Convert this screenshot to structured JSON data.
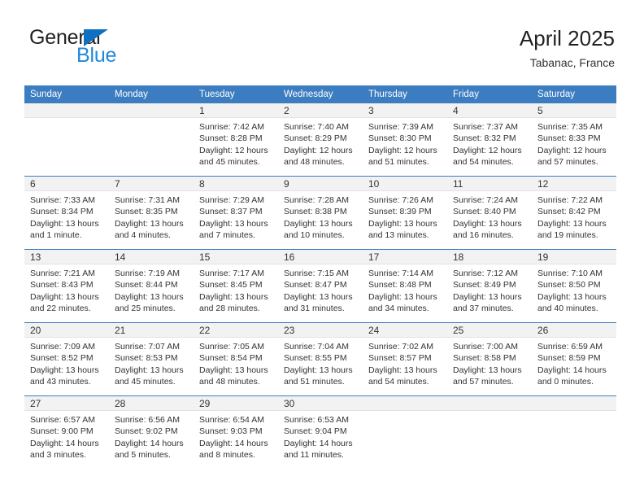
{
  "logo": {
    "word1": "General",
    "word2": "Blue",
    "triangle_color": "#0f6fc0",
    "blue_color": "#2288dd"
  },
  "header": {
    "title": "April 2025",
    "subtitle": "Tabanac, France",
    "accent_color": "#3b7dc0",
    "daynum_band_color": "#f2f2f2"
  },
  "weekdays": [
    "Sunday",
    "Monday",
    "Tuesday",
    "Wednesday",
    "Thursday",
    "Friday",
    "Saturday"
  ],
  "weeks": [
    [
      {
        "day": "",
        "sunrise": "",
        "sunset": "",
        "daylight": "",
        "daylight2": ""
      },
      {
        "day": "",
        "sunrise": "",
        "sunset": "",
        "daylight": "",
        "daylight2": ""
      },
      {
        "day": "1",
        "sunrise": "Sunrise: 7:42 AM",
        "sunset": "Sunset: 8:28 PM",
        "daylight": "Daylight: 12 hours",
        "daylight2": "and 45 minutes."
      },
      {
        "day": "2",
        "sunrise": "Sunrise: 7:40 AM",
        "sunset": "Sunset: 8:29 PM",
        "daylight": "Daylight: 12 hours",
        "daylight2": "and 48 minutes."
      },
      {
        "day": "3",
        "sunrise": "Sunrise: 7:39 AM",
        "sunset": "Sunset: 8:30 PM",
        "daylight": "Daylight: 12 hours",
        "daylight2": "and 51 minutes."
      },
      {
        "day": "4",
        "sunrise": "Sunrise: 7:37 AM",
        "sunset": "Sunset: 8:32 PM",
        "daylight": "Daylight: 12 hours",
        "daylight2": "and 54 minutes."
      },
      {
        "day": "5",
        "sunrise": "Sunrise: 7:35 AM",
        "sunset": "Sunset: 8:33 PM",
        "daylight": "Daylight: 12 hours",
        "daylight2": "and 57 minutes."
      }
    ],
    [
      {
        "day": "6",
        "sunrise": "Sunrise: 7:33 AM",
        "sunset": "Sunset: 8:34 PM",
        "daylight": "Daylight: 13 hours",
        "daylight2": "and 1 minute."
      },
      {
        "day": "7",
        "sunrise": "Sunrise: 7:31 AM",
        "sunset": "Sunset: 8:35 PM",
        "daylight": "Daylight: 13 hours",
        "daylight2": "and 4 minutes."
      },
      {
        "day": "8",
        "sunrise": "Sunrise: 7:29 AM",
        "sunset": "Sunset: 8:37 PM",
        "daylight": "Daylight: 13 hours",
        "daylight2": "and 7 minutes."
      },
      {
        "day": "9",
        "sunrise": "Sunrise: 7:28 AM",
        "sunset": "Sunset: 8:38 PM",
        "daylight": "Daylight: 13 hours",
        "daylight2": "and 10 minutes."
      },
      {
        "day": "10",
        "sunrise": "Sunrise: 7:26 AM",
        "sunset": "Sunset: 8:39 PM",
        "daylight": "Daylight: 13 hours",
        "daylight2": "and 13 minutes."
      },
      {
        "day": "11",
        "sunrise": "Sunrise: 7:24 AM",
        "sunset": "Sunset: 8:40 PM",
        "daylight": "Daylight: 13 hours",
        "daylight2": "and 16 minutes."
      },
      {
        "day": "12",
        "sunrise": "Sunrise: 7:22 AM",
        "sunset": "Sunset: 8:42 PM",
        "daylight": "Daylight: 13 hours",
        "daylight2": "and 19 minutes."
      }
    ],
    [
      {
        "day": "13",
        "sunrise": "Sunrise: 7:21 AM",
        "sunset": "Sunset: 8:43 PM",
        "daylight": "Daylight: 13 hours",
        "daylight2": "and 22 minutes."
      },
      {
        "day": "14",
        "sunrise": "Sunrise: 7:19 AM",
        "sunset": "Sunset: 8:44 PM",
        "daylight": "Daylight: 13 hours",
        "daylight2": "and 25 minutes."
      },
      {
        "day": "15",
        "sunrise": "Sunrise: 7:17 AM",
        "sunset": "Sunset: 8:45 PM",
        "daylight": "Daylight: 13 hours",
        "daylight2": "and 28 minutes."
      },
      {
        "day": "16",
        "sunrise": "Sunrise: 7:15 AM",
        "sunset": "Sunset: 8:47 PM",
        "daylight": "Daylight: 13 hours",
        "daylight2": "and 31 minutes."
      },
      {
        "day": "17",
        "sunrise": "Sunrise: 7:14 AM",
        "sunset": "Sunset: 8:48 PM",
        "daylight": "Daylight: 13 hours",
        "daylight2": "and 34 minutes."
      },
      {
        "day": "18",
        "sunrise": "Sunrise: 7:12 AM",
        "sunset": "Sunset: 8:49 PM",
        "daylight": "Daylight: 13 hours",
        "daylight2": "and 37 minutes."
      },
      {
        "day": "19",
        "sunrise": "Sunrise: 7:10 AM",
        "sunset": "Sunset: 8:50 PM",
        "daylight": "Daylight: 13 hours",
        "daylight2": "and 40 minutes."
      }
    ],
    [
      {
        "day": "20",
        "sunrise": "Sunrise: 7:09 AM",
        "sunset": "Sunset: 8:52 PM",
        "daylight": "Daylight: 13 hours",
        "daylight2": "and 43 minutes."
      },
      {
        "day": "21",
        "sunrise": "Sunrise: 7:07 AM",
        "sunset": "Sunset: 8:53 PM",
        "daylight": "Daylight: 13 hours",
        "daylight2": "and 45 minutes."
      },
      {
        "day": "22",
        "sunrise": "Sunrise: 7:05 AM",
        "sunset": "Sunset: 8:54 PM",
        "daylight": "Daylight: 13 hours",
        "daylight2": "and 48 minutes."
      },
      {
        "day": "23",
        "sunrise": "Sunrise: 7:04 AM",
        "sunset": "Sunset: 8:55 PM",
        "daylight": "Daylight: 13 hours",
        "daylight2": "and 51 minutes."
      },
      {
        "day": "24",
        "sunrise": "Sunrise: 7:02 AM",
        "sunset": "Sunset: 8:57 PM",
        "daylight": "Daylight: 13 hours",
        "daylight2": "and 54 minutes."
      },
      {
        "day": "25",
        "sunrise": "Sunrise: 7:00 AM",
        "sunset": "Sunset: 8:58 PM",
        "daylight": "Daylight: 13 hours",
        "daylight2": "and 57 minutes."
      },
      {
        "day": "26",
        "sunrise": "Sunrise: 6:59 AM",
        "sunset": "Sunset: 8:59 PM",
        "daylight": "Daylight: 14 hours",
        "daylight2": "and 0 minutes."
      }
    ],
    [
      {
        "day": "27",
        "sunrise": "Sunrise: 6:57 AM",
        "sunset": "Sunset: 9:00 PM",
        "daylight": "Daylight: 14 hours",
        "daylight2": "and 3 minutes."
      },
      {
        "day": "28",
        "sunrise": "Sunrise: 6:56 AM",
        "sunset": "Sunset: 9:02 PM",
        "daylight": "Daylight: 14 hours",
        "daylight2": "and 5 minutes."
      },
      {
        "day": "29",
        "sunrise": "Sunrise: 6:54 AM",
        "sunset": "Sunset: 9:03 PM",
        "daylight": "Daylight: 14 hours",
        "daylight2": "and 8 minutes."
      },
      {
        "day": "30",
        "sunrise": "Sunrise: 6:53 AM",
        "sunset": "Sunset: 9:04 PM",
        "daylight": "Daylight: 14 hours",
        "daylight2": "and 11 minutes."
      },
      {
        "day": "",
        "sunrise": "",
        "sunset": "",
        "daylight": "",
        "daylight2": ""
      },
      {
        "day": "",
        "sunrise": "",
        "sunset": "",
        "daylight": "",
        "daylight2": ""
      },
      {
        "day": "",
        "sunrise": "",
        "sunset": "",
        "daylight": "",
        "daylight2": ""
      }
    ]
  ]
}
